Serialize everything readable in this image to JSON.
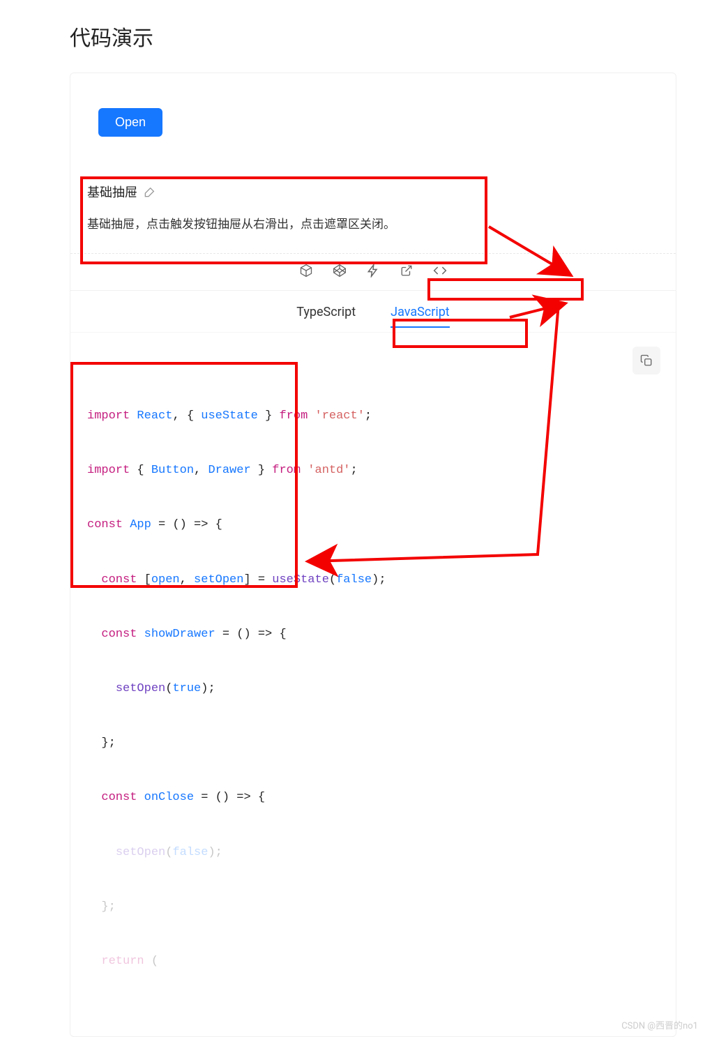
{
  "page": {
    "title": "代码演示"
  },
  "demo": {
    "open_button": "Open",
    "desc_title": "基础抽屉",
    "desc_text": "基础抽屉，点击触发按钮抽屉从右滑出，点击遮罩区关闭。"
  },
  "toolbar": {
    "icons": {
      "codesandbox": "codesandbox-icon",
      "codepen": "codepen-icon",
      "thunder": "thunder-icon",
      "external": "external-icon",
      "code": "code-icon"
    }
  },
  "tabs": {
    "typescript": "TypeScript",
    "javascript": "JavaScript",
    "active": "javascript"
  },
  "code": {
    "l1": {
      "kw1": "import",
      "id1": "React",
      "pl1": ", { ",
      "id2": "useState",
      "pl2": " } ",
      "kw2": "from",
      "str": "'react'",
      "end": ";"
    },
    "l2": {
      "kw1": "import",
      "pl1": " { ",
      "id1": "Button",
      "pl2": ", ",
      "id2": "Drawer",
      "pl3": " } ",
      "kw2": "from",
      "str": "'antd'",
      "end": ";"
    },
    "l3": {
      "kw": "const",
      "id": "App",
      "rest": " = () => {"
    },
    "l4": {
      "ind": "  ",
      "kw": "const",
      "pl1": " [",
      "id1": "open",
      "pl2": ", ",
      "id2": "setOpen",
      "pl3": "] = ",
      "fn": "useState",
      "pl4": "(",
      "lit": "false",
      "pl5": ");"
    },
    "l5": {
      "ind": "  ",
      "kw": "const",
      "id": " showDrawer",
      "rest": " = () => {"
    },
    "l6": {
      "ind": "    ",
      "fn": "setOpen",
      "pl1": "(",
      "lit": "true",
      "pl2": ");"
    },
    "l7": {
      "ind": "  ",
      "txt": "};"
    },
    "l8": {
      "ind": "  ",
      "kw": "const",
      "id": " onClose",
      "rest": " = () => {"
    },
    "l9": {
      "ind": "    ",
      "fn": "setOpen",
      "pl1": "(",
      "lit": "false",
      "pl2": ");"
    },
    "l10": {
      "ind": "  ",
      "txt": "};"
    },
    "l11": {
      "ind": "  ",
      "kw": "return",
      "rest": " ("
    }
  },
  "watermark": "CSDN @西晋的no1"
}
